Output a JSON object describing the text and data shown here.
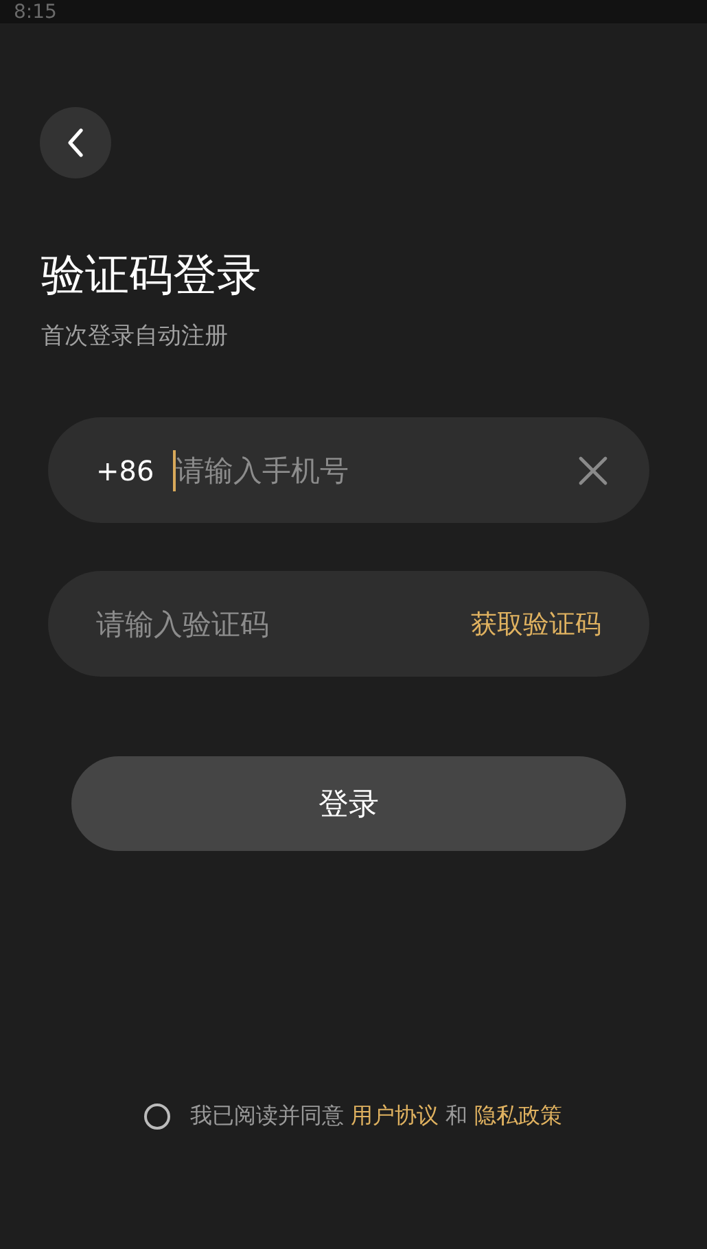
{
  "status_bar": {
    "time": "8:15"
  },
  "title": "验证码登录",
  "subtitle": "首次登录自动注册",
  "phone_field": {
    "prefix": "+86",
    "placeholder": "请输入手机号"
  },
  "code_field": {
    "placeholder": "请输入验证码",
    "action": "获取验证码"
  },
  "login_button": "登录",
  "agreement": {
    "checked": false,
    "text": "我已阅读并同意",
    "link_1": "用户协议",
    "joiner": "和",
    "link_2": "隐私政策"
  }
}
